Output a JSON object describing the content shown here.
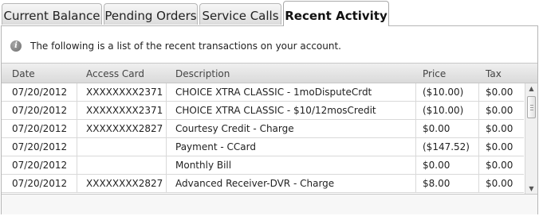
{
  "tabs": [
    {
      "label": "Current Balance",
      "active": false
    },
    {
      "label": "Pending Orders",
      "active": false
    },
    {
      "label": "Service Calls",
      "active": false
    },
    {
      "label": "Recent Activity",
      "active": true
    }
  ],
  "info": {
    "icon": "info-icon",
    "text": "The following is a list of the recent transactions on your account."
  },
  "table": {
    "columns": [
      "Date",
      "Access Card",
      "Description",
      "Price",
      "Tax"
    ],
    "rows": [
      {
        "date": "07/20/2012",
        "card": "XXXXXXXX2371",
        "description": "CHOICE XTRA CLASSIC - 1moDisputeCrdt",
        "price": "($10.00)",
        "tax": "$0.00"
      },
      {
        "date": "07/20/2012",
        "card": "XXXXXXXX2371",
        "description": "CHOICE XTRA CLASSIC - $10/12mosCredit",
        "price": "($10.00)",
        "tax": "$0.00"
      },
      {
        "date": "07/20/2012",
        "card": "XXXXXXXX2827",
        "description": "Courtesy Credit - Charge",
        "price": "$0.00",
        "tax": "$0.00"
      },
      {
        "date": "07/20/2012",
        "card": "",
        "description": "Payment - CCard",
        "price": "($147.52)",
        "tax": "$0.00"
      },
      {
        "date": "07/20/2012",
        "card": "",
        "description": "Monthly Bill",
        "price": "$0.00",
        "tax": "$0.00"
      },
      {
        "date": "07/20/2012",
        "card": "XXXXXXXX2827",
        "description": "Advanced Receiver-DVR - Charge",
        "price": "$8.00",
        "tax": "$0.00"
      }
    ]
  },
  "scrollbar": {
    "up_icon": "arrow-up-icon",
    "down_icon": "arrow-down-icon"
  },
  "colors": {
    "header_bg": "#e3e3e3",
    "border": "#b6b6b6",
    "row_border": "#d9d9d9"
  }
}
